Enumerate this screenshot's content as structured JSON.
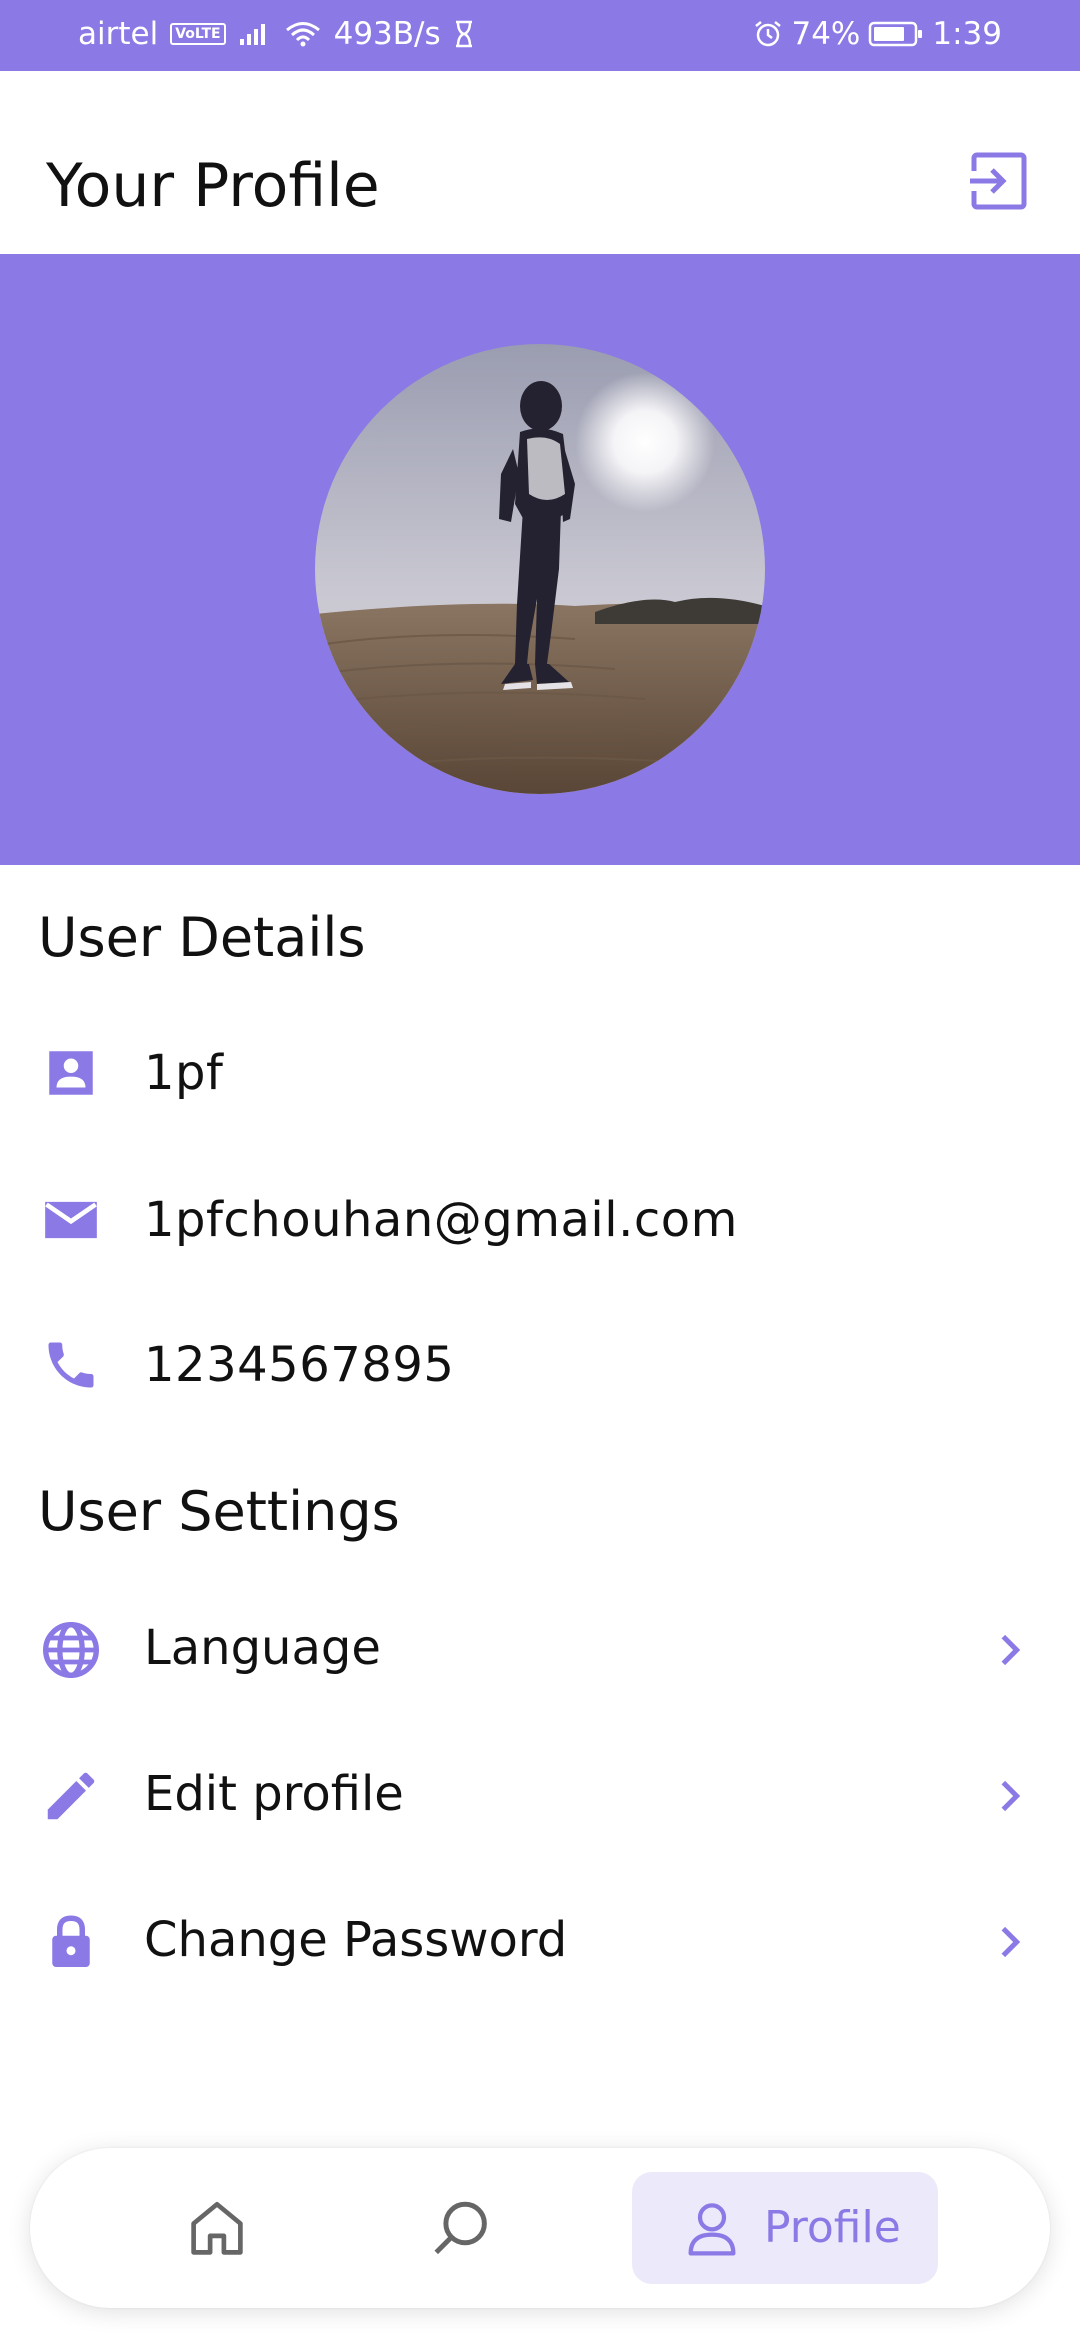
{
  "status_bar": {
    "carrier": "airtel",
    "volte": "VoLTE",
    "speed": "493B/s",
    "battery": "74%",
    "time": "1:39"
  },
  "header": {
    "title": "Your Profile",
    "logout_icon": "logout-icon"
  },
  "profile": {
    "avatar_description_icon": "avatar-photo"
  },
  "user_details": {
    "title": "User Details",
    "items": [
      {
        "icon": "person-icon",
        "value": "1pf"
      },
      {
        "icon": "email-icon",
        "value": "1pfchouhan@gmail.com"
      },
      {
        "icon": "phone-icon",
        "value": "1234567895"
      }
    ]
  },
  "user_settings": {
    "title": "User Settings",
    "items": [
      {
        "icon": "globe-icon",
        "label": "Language"
      },
      {
        "icon": "pencil-icon",
        "label": "Edit profile"
      },
      {
        "icon": "lock-icon",
        "label": "Change Password"
      }
    ]
  },
  "bottom_nav": {
    "items": [
      {
        "icon": "home-icon",
        "label": ""
      },
      {
        "icon": "search-icon",
        "label": ""
      },
      {
        "icon": "profile-icon",
        "label": "Profile",
        "active": true
      }
    ]
  },
  "colors": {
    "accent": "#8b79e6",
    "active_nav_bg": "#ece9fb",
    "text": "#111111"
  }
}
